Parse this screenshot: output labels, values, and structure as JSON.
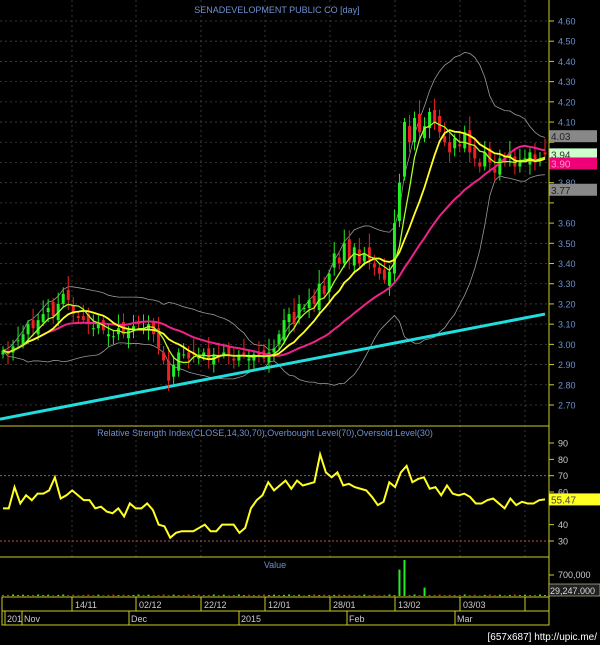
{
  "chart_data": [
    {
      "type": "candlestick",
      "title": "SENADEVELOPMENT PUBLIC CO [day]",
      "y_ticks": [
        2.7,
        2.8,
        2.9,
        3.0,
        3.1,
        3.2,
        3.3,
        3.4,
        3.5,
        3.6,
        3.7,
        3.8,
        3.9,
        4.0,
        4.1,
        4.2,
        4.3,
        4.4,
        4.5,
        4.6
      ],
      "y_tick_labels": [
        "2.70",
        "2.80",
        "2.90",
        "3.00",
        "3.10",
        "3.20",
        "3.30",
        "3.40",
        "3.50",
        "3.60",
        "",
        "3.80",
        "",
        "",
        "4.10",
        "4.20",
        "4.30",
        "4.40",
        "4.50",
        "4.60"
      ],
      "ylim": [
        2.62,
        4.7
      ],
      "grid": true,
      "close": [
        2.97,
        2.95,
        2.99,
        3.02,
        3.05,
        3.1,
        3.08,
        3.12,
        3.15,
        3.18,
        3.14,
        3.2,
        3.25,
        3.22,
        3.15,
        3.13,
        3.12,
        3.1,
        3.08,
        3.1,
        3.07,
        3.05,
        3.04,
        3.08,
        3.05,
        3.07,
        3.09,
        3.1,
        3.08,
        3.1,
        3.05,
        2.98,
        2.92,
        2.82,
        2.9,
        2.96,
        2.95,
        2.93,
        2.95,
        2.94,
        2.96,
        2.93,
        2.95,
        2.94,
        2.96,
        2.95,
        2.92,
        2.94,
        2.95,
        2.93,
        2.95,
        2.94,
        2.93,
        2.96,
        2.98,
        3.05,
        3.12,
        3.15,
        3.1,
        3.2,
        3.18,
        3.22,
        3.2,
        3.3,
        3.25,
        3.35,
        3.45,
        3.4,
        3.5,
        3.42,
        3.48,
        3.4,
        3.45,
        3.42,
        3.38,
        3.35,
        3.32,
        3.36,
        3.6,
        3.8,
        4.1,
        4.0,
        4.12,
        4.05,
        4.08,
        4.15,
        4.1,
        4.05,
        4.0,
        3.95,
        4.02,
        3.98,
        4.05,
        3.95,
        3.92,
        3.88,
        3.95,
        3.9,
        3.85,
        3.92,
        3.9,
        3.95,
        3.88,
        3.9,
        3.92,
        3.95,
        3.9,
        3.92,
        3.94
      ],
      "long_ma_start": 2.63,
      "long_ma_end": 3.15,
      "colors": {
        "up": "#22ee22",
        "down": "#ee2222",
        "ma_short": "#aaff22",
        "ma_mid": "#ffff22",
        "ma_long": "#ee2288",
        "ma_trend": "#22dddd",
        "bands": "#999999",
        "axis": "#cccc22",
        "tick_text": "#6f8fcf"
      },
      "markers": [
        {
          "label": "4.03",
          "value": 4.03,
          "bg": "#888888",
          "fg": "#222222"
        },
        {
          "label": "3.94",
          "value": 3.94,
          "bg": "#ccffcc",
          "fg": "#333333"
        },
        {
          "label": "3.90",
          "value": 3.895,
          "bg": "#ee0077",
          "fg": "#ff99cc"
        },
        {
          "label": "3.77",
          "value": 3.765,
          "bg": "#888888",
          "fg": "#222222"
        }
      ]
    },
    {
      "type": "line",
      "title": "Relative Strength Index(CLOSE,14,30,70),Overbought Level(70),Oversold Level(30)",
      "y_ticks": [
        30,
        40,
        60,
        70,
        80,
        90
      ],
      "ylim": [
        22,
        95
      ],
      "overbought": 70,
      "oversold": 30,
      "values": [
        50,
        50,
        63,
        53,
        58,
        55,
        59,
        59,
        61,
        69,
        56,
        58,
        61,
        58,
        55,
        55,
        50,
        51,
        48,
        47,
        50,
        45,
        53,
        50,
        50,
        53,
        49,
        40,
        39,
        32,
        35,
        36,
        36,
        36,
        38,
        40,
        36,
        36,
        40,
        40,
        40,
        35,
        38,
        50,
        55,
        58,
        66,
        61,
        64,
        67,
        62,
        67,
        64,
        65,
        66,
        83,
        72,
        69,
        72,
        64,
        65,
        63,
        62,
        61,
        57,
        52,
        54,
        66,
        63,
        72,
        76,
        66,
        68,
        69,
        62,
        63,
        58,
        64,
        59,
        58,
        59,
        57,
        53,
        53,
        55,
        56,
        53,
        50,
        56,
        52,
        54,
        53,
        53,
        55,
        55.47
      ],
      "last_label": "55.47"
    },
    {
      "type": "bar",
      "title": "Value",
      "y_tick_label": "700,000",
      "last_label": "29,247.000",
      "volume_spikes": {
        "79": 1100000,
        "80": 1500000,
        "84": 350000
      }
    }
  ],
  "x_axis": {
    "ticks": [
      "14/11",
      "02/12",
      "22/12",
      "12/01",
      "28/01",
      "13/02",
      "03/03"
    ],
    "months": [
      "201",
      "Nov",
      "Dec",
      "2015",
      "Feb",
      "Mar"
    ]
  },
  "footer": {
    "text": "[657x687] http://upic.me/"
  }
}
